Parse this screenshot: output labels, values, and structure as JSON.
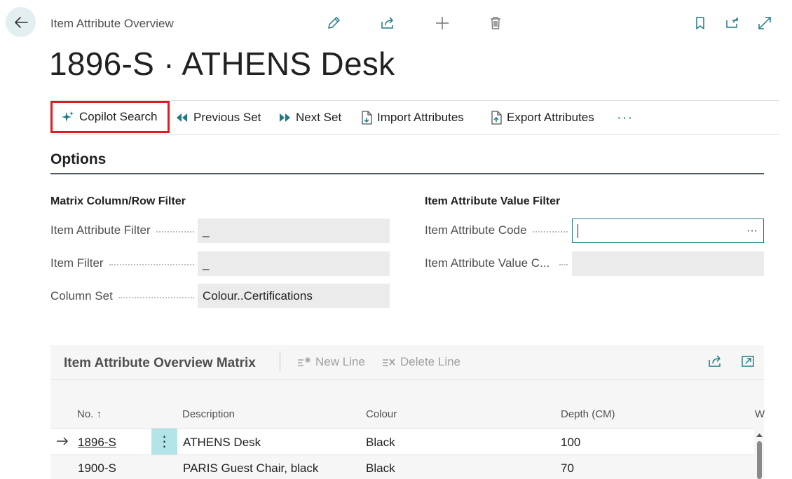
{
  "header": {
    "breadcrumb": "Item Attribute Overview",
    "title": "1896-S · ATHENS Desk"
  },
  "actions": {
    "copilot": "Copilot Search",
    "previous_set": "Previous Set",
    "next_set": "Next Set",
    "import": "Import Attributes",
    "export": "Export Attributes",
    "more": "···"
  },
  "options": {
    "heading": "Options",
    "left_group": {
      "heading": "Matrix Column/Row Filter",
      "fields": [
        {
          "label": "Item Attribute Filter",
          "value": "_"
        },
        {
          "label": "Item Filter",
          "value": "_"
        },
        {
          "label": "Column Set",
          "value": "Colour..Certifications"
        }
      ]
    },
    "right_group": {
      "heading": "Item Attribute Value Filter",
      "fields": [
        {
          "label": "Item Attribute Code",
          "value": "",
          "assist": "···"
        },
        {
          "label": "Item Attribute Value C...",
          "value": ""
        }
      ]
    }
  },
  "matrix": {
    "title": "Item Attribute Overview Matrix",
    "new_line": "New Line",
    "delete_line": "Delete Line",
    "columns": [
      "No. ↑",
      "Description",
      "Colour",
      "Depth (CM)",
      "W"
    ],
    "rows": [
      {
        "no": "1896-S",
        "description": "ATHENS Desk",
        "colour": "Black",
        "depth": "100",
        "row_menu": "⋮"
      },
      {
        "no": "1900-S",
        "description": "PARIS Guest Chair, black",
        "colour": "Black",
        "depth": "70"
      }
    ]
  },
  "colors": {
    "accent": "#1f7a84",
    "highlight_border": "#e01b24",
    "selected_row_menu": "#b3e4e8"
  }
}
